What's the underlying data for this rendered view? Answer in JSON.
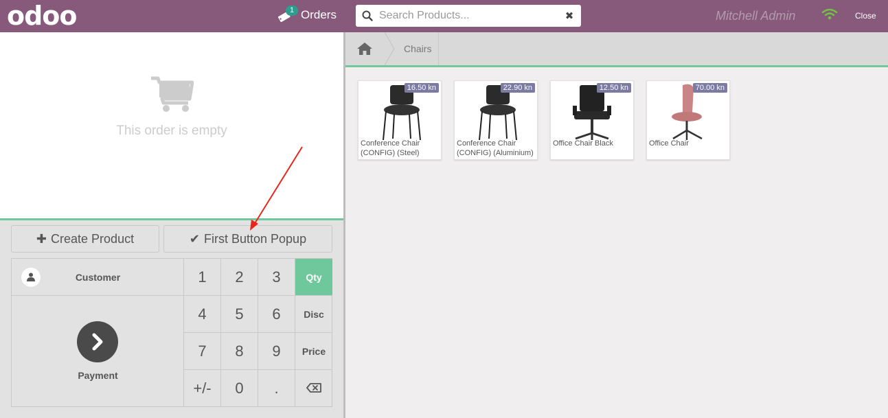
{
  "header": {
    "logo": "odoo",
    "orders_count": "1",
    "orders_label": "Orders",
    "search_placeholder": "Search Products...",
    "clear_icon": "✖",
    "user_name": "Mitchell Admin",
    "close_label": "Close"
  },
  "order": {
    "empty_text": "This order is empty"
  },
  "controls": {
    "create_product_icon": "✚",
    "create_product": "Create Product",
    "first_popup_icon": "✔",
    "first_popup": "First Button Popup"
  },
  "pad": {
    "customer": "Customer",
    "payment": "Payment",
    "keys": [
      "1",
      "2",
      "3",
      "4",
      "5",
      "6",
      "7",
      "8",
      "9",
      "+/-",
      "0",
      "."
    ],
    "modes": [
      "Qty",
      "Disc",
      "Price"
    ],
    "active_mode": "Qty",
    "backspace": "⌫"
  },
  "breadcrumb": {
    "category": "Chairs"
  },
  "products": [
    {
      "name": "Conference Chair (CONFIG) (Steel)",
      "price": "16.50 kn",
      "color": "#2b2b2b"
    },
    {
      "name": "Conference Chair (CONFIG) (Aluminium)",
      "price": "22.90 kn",
      "color": "#2b2b2b"
    },
    {
      "name": "Office Chair Black",
      "price": "12.50 kn",
      "color": "#222222"
    },
    {
      "name": "Office Chair",
      "price": "70.00 kn",
      "color": "#c98585"
    }
  ],
  "colors": {
    "topbar": "#875a7b",
    "accent": "#6ec89b",
    "price_badge": "#7a7aa3",
    "annotation_arrow": "#e8261b"
  }
}
